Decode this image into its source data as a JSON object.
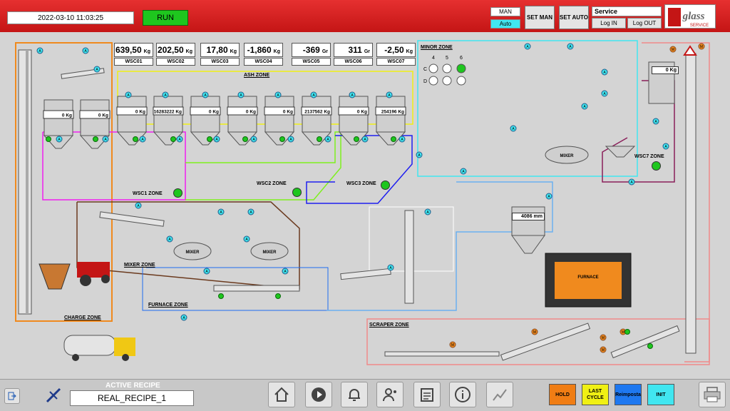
{
  "header": {
    "datetime": "2022-03-10 11:03:25",
    "run_label": "RUN",
    "mode_man": "MAN",
    "mode_auto": "Auto",
    "set_man": "SET MAN",
    "set_auto": "SET AUTO",
    "user": "Service",
    "login": "Log IN",
    "logout": "Log OUT",
    "logo_text": "glass",
    "logo_sub": "SERVICE"
  },
  "scales": [
    {
      "value": "639,50",
      "unit": "Kg",
      "label": "WSC01"
    },
    {
      "value": "202,50",
      "unit": "Kg",
      "label": "WSC02"
    },
    {
      "value": "17,80",
      "unit": "Kg",
      "label": "WSC03"
    },
    {
      "value": "-1,860",
      "unit": "Kg",
      "label": "WSC04"
    },
    {
      "value": "-369",
      "unit": "Gr",
      "label": "WSC05"
    },
    {
      "value": "311",
      "unit": "Gr",
      "label": "WSC06"
    },
    {
      "value": "-2,50",
      "unit": "Kg",
      "label": "WSC07"
    }
  ],
  "zones": {
    "ash": "ASH ZONE",
    "minor": "MINOR ZONE",
    "wsc1": "WSC1 ZONE",
    "wsc2": "WSC2 ZONE",
    "wsc3": "WSC3 ZONE",
    "wsc7": "WSC7 ZONE",
    "mixer": "MIXER ZONE",
    "furnace": "FURNACE ZONE",
    "charge": "CHARGE ZONE",
    "scraper": "SCRAPER ZONE"
  },
  "silo_values": [
    "0",
    "0",
    "0",
    "16283222",
    "0",
    "0",
    "0",
    "2137562",
    "0",
    "254196"
  ],
  "silo_unit": "Kg",
  "wsc7_value": "0",
  "furnace_level": "4086",
  "furnace_unit": "mm",
  "labels": {
    "mixer": "MIXER",
    "furnace": "FURNACE",
    "marker_a": "A",
    "marker_m": "M"
  },
  "minor_grid": {
    "cols": [
      "4",
      "5",
      "6"
    ],
    "rows": [
      "C",
      "D"
    ]
  },
  "footer": {
    "recipe_title": "ACTIVE RECIPE",
    "recipe_name": "REAL_RECIPE_1",
    "hold": "HOLD",
    "last_cycle": "LAST CYCLE",
    "reimposta": "Reimposta",
    "init": "INIT"
  },
  "colors": {
    "header": "#d81e1e",
    "run": "#1ec61e",
    "auto": "#41e6f0",
    "hold": "#f07d14",
    "last_cycle": "#f0f014",
    "reimposta": "#1e78f0",
    "init": "#41e6f0"
  }
}
